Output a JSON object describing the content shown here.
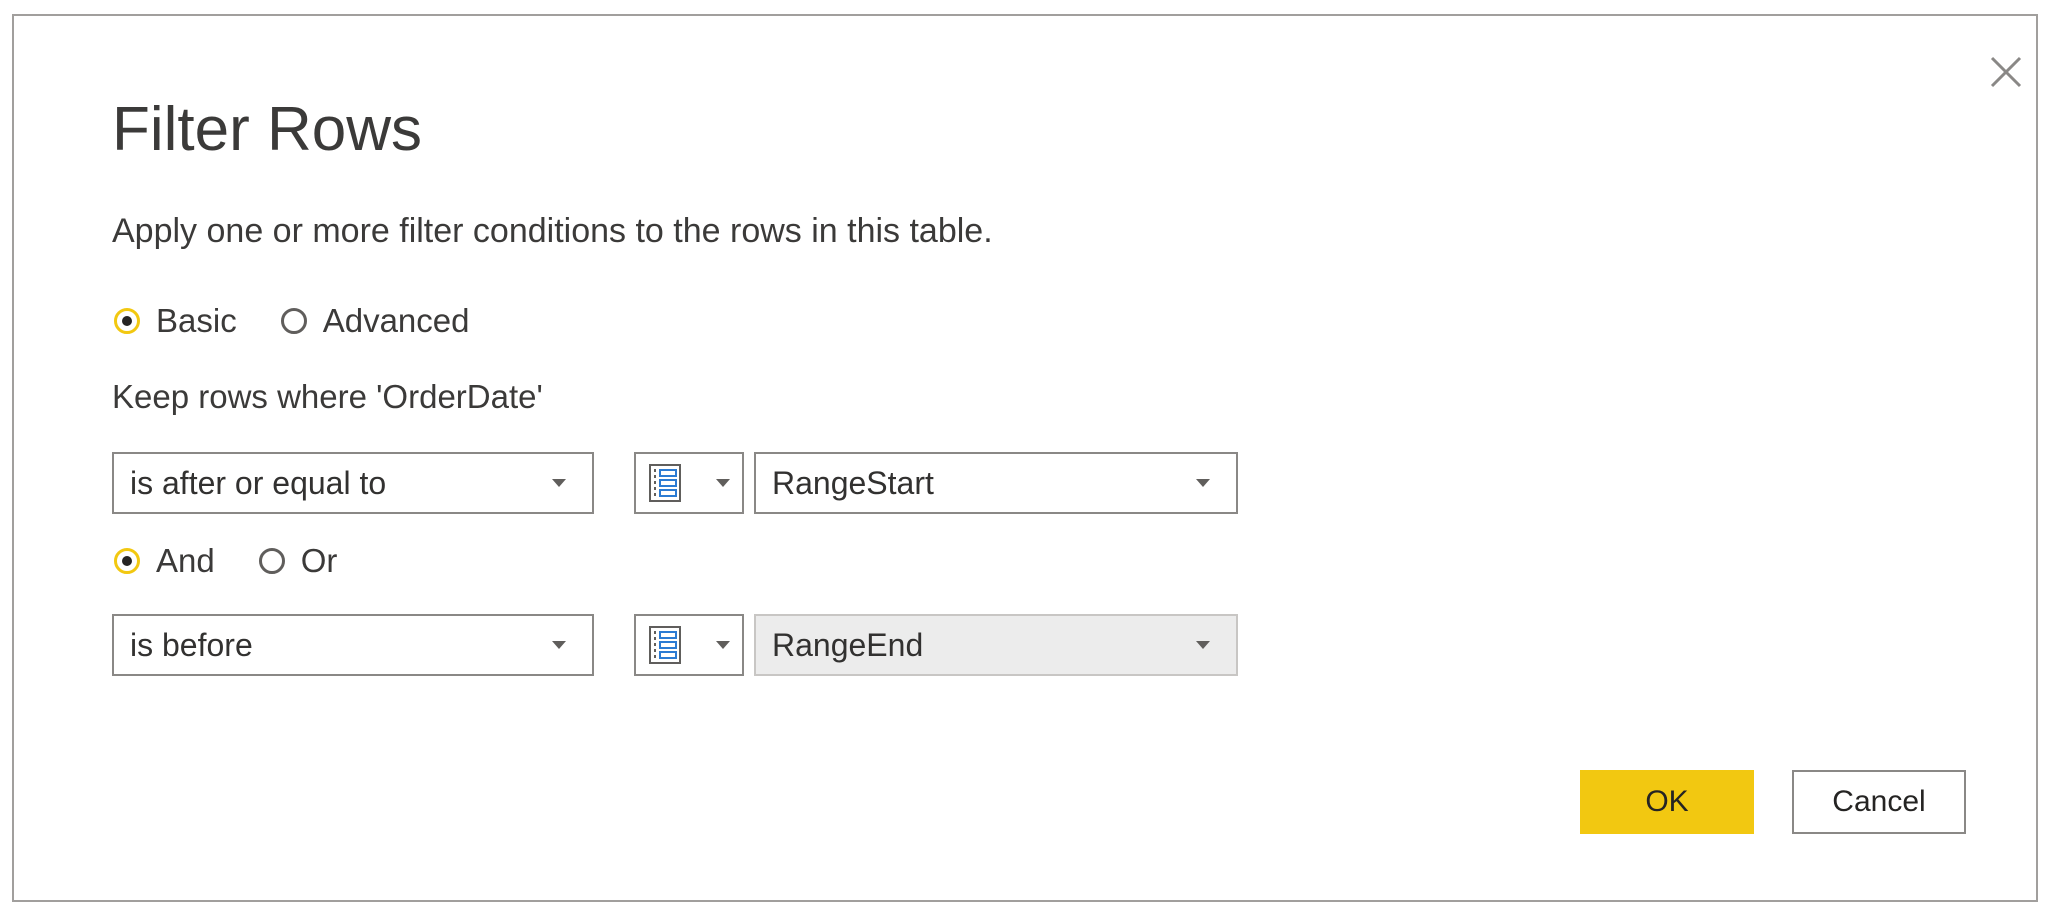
{
  "dialog": {
    "title": "Filter Rows",
    "subtitle": "Apply one or more filter conditions to the rows in this table."
  },
  "mode": {
    "options": [
      {
        "label": "Basic",
        "selected": true
      },
      {
        "label": "Advanced",
        "selected": false
      }
    ]
  },
  "keep_label": "Keep rows where 'OrderDate'",
  "conditions": [
    {
      "operator": "is after or equal to",
      "value_type_icon": "parameter-icon",
      "value": "RangeStart",
      "disabled": false
    },
    {
      "operator": "is before",
      "value_type_icon": "parameter-icon",
      "value": "RangeEnd",
      "disabled": true
    }
  ],
  "logic": {
    "options": [
      {
        "label": "And",
        "selected": true
      },
      {
        "label": "Or",
        "selected": false
      }
    ]
  },
  "buttons": {
    "ok": "OK",
    "cancel": "Cancel"
  },
  "colors": {
    "accent": "#f2c811",
    "border": "#8a8886",
    "disabled_bg": "#ececec"
  }
}
